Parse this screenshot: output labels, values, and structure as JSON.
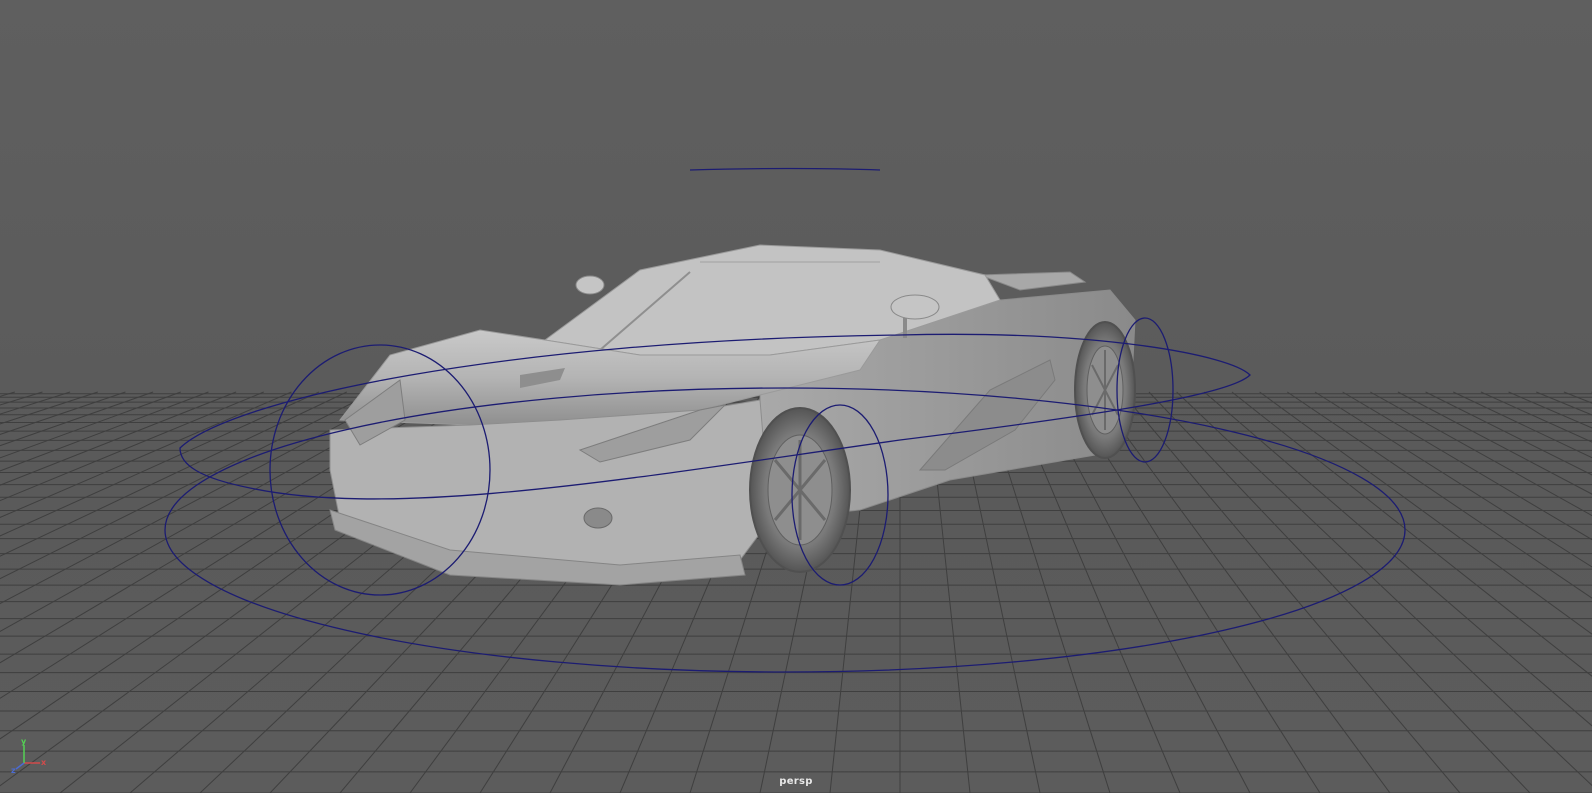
{
  "viewport": {
    "camera_name": "persp",
    "background_color": "#5d5d5d",
    "grid_color": "#3f3f3f",
    "nurbs_curve_color": "#1a1a6e",
    "car_shade_color": "#b9b9b9"
  },
  "axis_gizmo": {
    "x_label": "x",
    "y_label": "y",
    "z_label": "z",
    "x_color": "#d24b4b",
    "y_color": "#54d254",
    "z_color": "#4b6bd2"
  }
}
